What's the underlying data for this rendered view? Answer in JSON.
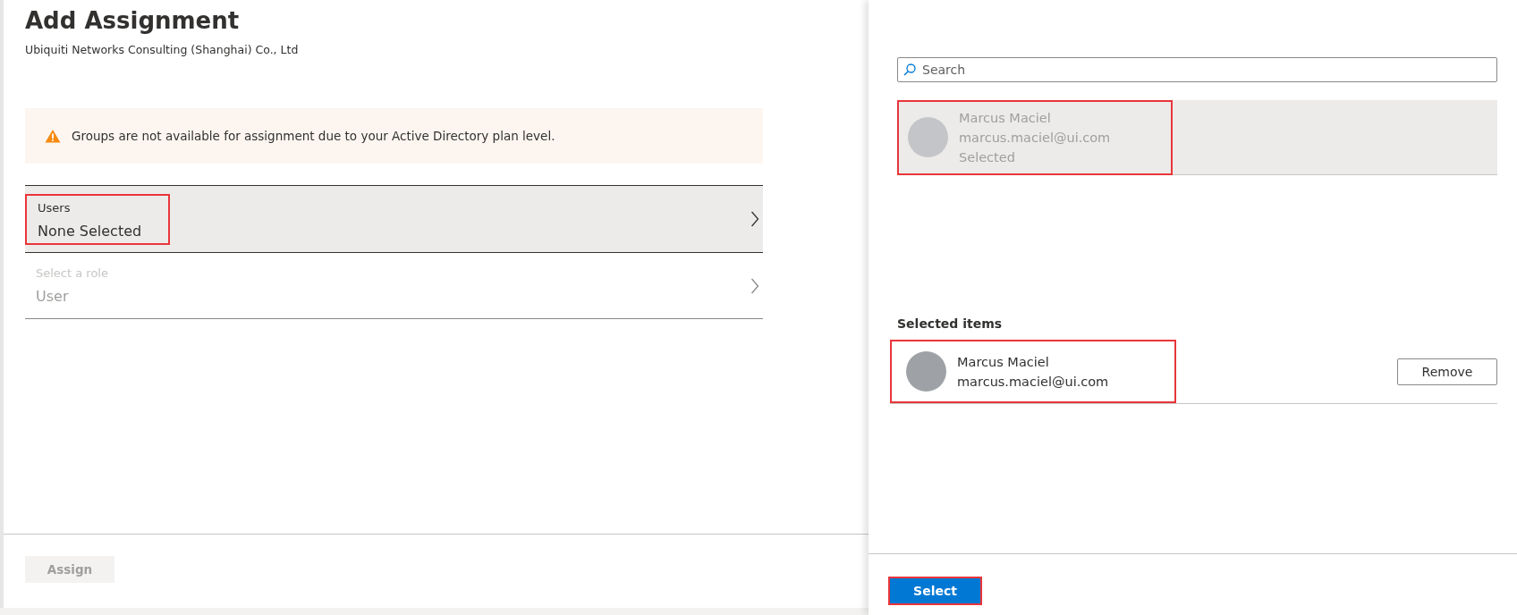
{
  "assignment": {
    "title": "Add Assignment",
    "subtitle": "Ubiquiti Networks Consulting (Shanghai) Co., Ltd",
    "warning": "Groups are not available for assignment due to your Active Directory plan level.",
    "fields": [
      {
        "label": "Users",
        "value": "None Selected",
        "selected": true,
        "disabled": false,
        "highlighted": true
      },
      {
        "label": "Select a role",
        "value": "User",
        "selected": false,
        "disabled": true,
        "highlighted": false
      }
    ],
    "assign_button": {
      "label": "Assign",
      "disabled": true
    }
  },
  "picker": {
    "search": {
      "placeholder": "Search"
    },
    "results": [
      {
        "name": "Marcus Maciel",
        "email": "marcus.maciel@ui.com",
        "status": "Selected",
        "selected": true,
        "highlighted": true
      }
    ],
    "selected_heading": "Selected items",
    "selected_items": [
      {
        "name": "Marcus Maciel",
        "email": "marcus.maciel@ui.com",
        "remove_label": "Remove",
        "highlighted": true
      }
    ],
    "select_button": {
      "label": "Select",
      "highlighted": true
    }
  }
}
